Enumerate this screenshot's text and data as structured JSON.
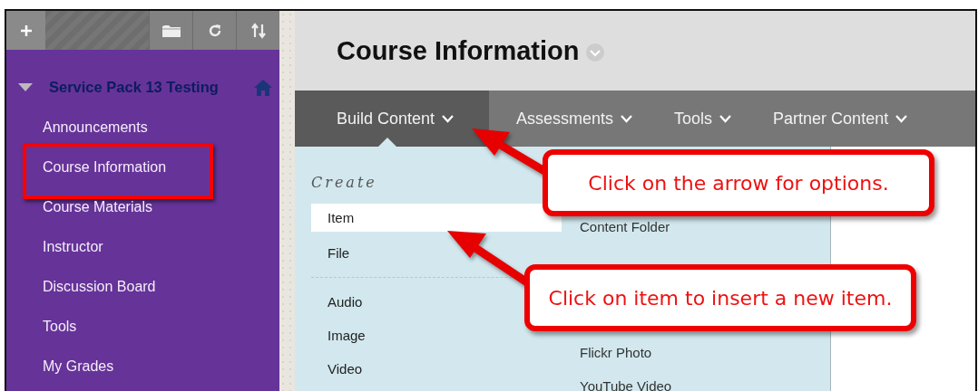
{
  "sidebar": {
    "course": {
      "title": "Service Pack 13 Testing",
      "expanded": true
    },
    "items": [
      {
        "label": "Announcements",
        "highlighted": false
      },
      {
        "label": "Course Information",
        "highlighted": true
      },
      {
        "label": "Course Materials",
        "highlighted": false
      },
      {
        "label": "Instructor",
        "highlighted": false
      },
      {
        "label": "Discussion Board",
        "highlighted": false
      },
      {
        "label": "Tools",
        "highlighted": false
      },
      {
        "label": "My Grades",
        "highlighted": false
      }
    ]
  },
  "page": {
    "title": "Course Information"
  },
  "nav": {
    "tabs": [
      {
        "label": "Build Content",
        "selected": true
      },
      {
        "label": "Assessments",
        "selected": false
      },
      {
        "label": "Tools",
        "selected": false
      },
      {
        "label": "Partner Content",
        "selected": false
      }
    ]
  },
  "dropdown": {
    "heading": "Create",
    "column_1": [
      [
        {
          "label": "Item",
          "selected": true
        },
        {
          "label": "File",
          "selected": false
        }
      ],
      [
        {
          "label": "Audio",
          "selected": false
        },
        {
          "label": "Image",
          "selected": false
        },
        {
          "label": "Video",
          "selected": false
        }
      ]
    ],
    "column_2": [
      [
        {
          "label": "Content Folder"
        }
      ],
      [
        {
          "label": "Flickr Photo"
        },
        {
          "label": "YouTube Video"
        }
      ]
    ]
  },
  "callouts": [
    "Click on the arrow for options.",
    "Click on item to insert a new item."
  ]
}
